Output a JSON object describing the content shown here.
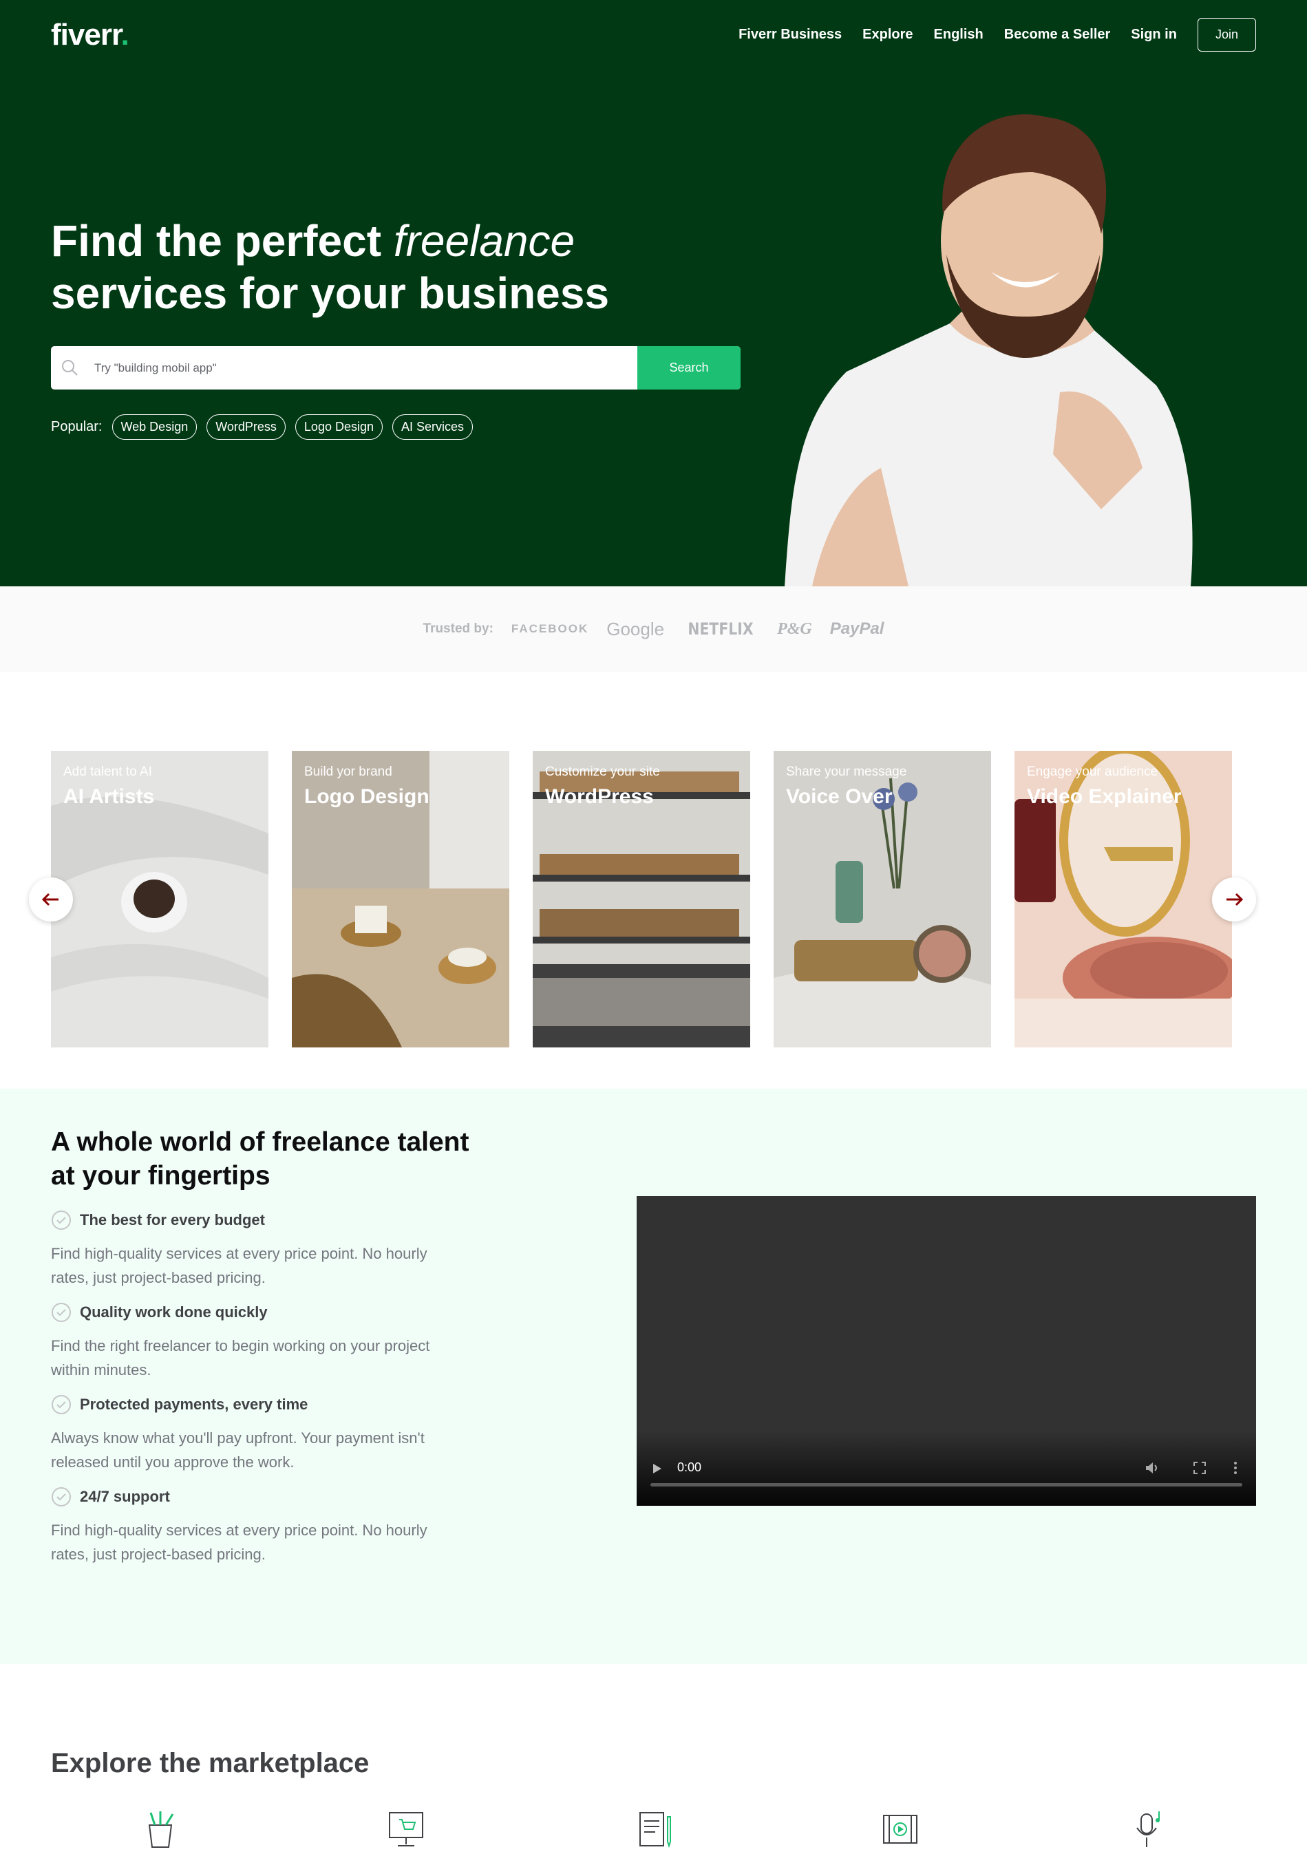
{
  "header": {
    "logo_text": "fiverr",
    "logo_dot": ".",
    "nav": [
      "Fiverr Business",
      "Explore",
      "English",
      "Become a Seller",
      "Sign in"
    ],
    "join_label": "Join"
  },
  "hero": {
    "title_part1": "Find the perfect ",
    "title_italic": "freelance",
    "title_part2": " services for your business",
    "search_placeholder": "Try \"building mobil app\"",
    "search_button": "Search",
    "popular_label": "Popular:",
    "popular_tags": [
      "Web Design",
      "WordPress",
      "Logo Design",
      "AI Services"
    ]
  },
  "trusted": {
    "label": "Trusted by:",
    "brands": [
      "FACEBOOK",
      "Google",
      "NETFLIX",
      "P&G",
      "PayPal"
    ]
  },
  "carousel": {
    "cards": [
      {
        "subtitle": "Add talent to AI",
        "title": "AI Artists"
      },
      {
        "subtitle": "Build yor brand",
        "title": "Logo Design"
      },
      {
        "subtitle": "Customize your site",
        "title": "WordPress"
      },
      {
        "subtitle": "Share your message",
        "title": "Voice Over"
      },
      {
        "subtitle": "Engage your audience",
        "title": "Video Explainer"
      }
    ]
  },
  "features": {
    "title": "A whole world of freelance talent at your fingertips",
    "items": [
      {
        "heading": "The best for every budget",
        "text": "Find high-quality services at every price point. No hourly rates, just project-based pricing."
      },
      {
        "heading": "Quality work done quickly",
        "text": "Find the right freelancer to begin working on your project within minutes."
      },
      {
        "heading": "Protected payments, every time",
        "text": "Always know what you'll pay upfront. Your payment isn't released until you approve the work."
      },
      {
        "heading": "24/7 support",
        "text": "Find high-quality services at every price point. No hourly rates, just project-based pricing."
      }
    ],
    "video_time": "0:00"
  },
  "marketplace": {
    "title": "Explore the marketplace",
    "icons": [
      "graphics-design-icon",
      "digital-marketing-icon",
      "writing-translation-icon",
      "video-animation-icon",
      "music-audio-icon"
    ]
  },
  "colors": {
    "hero_bg": "#013914",
    "accent": "#1dbf73",
    "features_bg": "#f1fdf7"
  }
}
